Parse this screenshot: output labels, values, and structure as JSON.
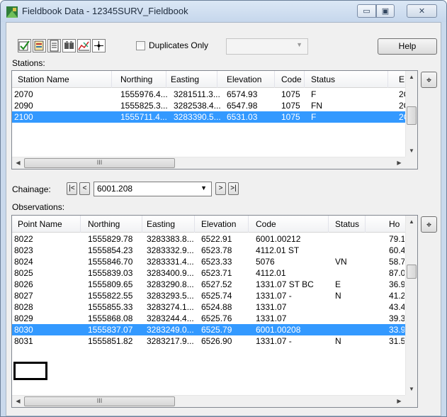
{
  "window": {
    "title": "Fieldbook Data - 12345SURV_Fieldbook",
    "controls": {
      "minimize": "▭",
      "maximize": "▣",
      "close": "✕"
    }
  },
  "toolbar": {
    "icons": [
      "fieldbook-edit-icon",
      "import-icon",
      "report-icon",
      "find-icon",
      "chart-icon",
      "locate-icon"
    ],
    "duplicates_only_label": "Duplicates Only",
    "duplicates_only_checked": false,
    "filter_value": "",
    "help_label": "Help"
  },
  "stations": {
    "label": "Stations:",
    "columns": [
      "Station Name",
      "Northing",
      "Easting",
      "Elevation",
      "Code",
      "Status",
      "E"
    ],
    "rows": [
      [
        "2070",
        "1555976.4...",
        "3281511.3...",
        "6574.93",
        "1075",
        "F",
        "2C"
      ],
      [
        "2090",
        "1555825.3...",
        "3282538.4...",
        "6547.98",
        "1075",
        "FN",
        "2C"
      ],
      [
        "2100",
        "1555711.4...",
        "3283390.5...",
        "6531.03",
        "1075",
        "F",
        "2C"
      ]
    ],
    "selected_row": 2,
    "locate_button": "⌖",
    "hscroll_grip": "III"
  },
  "chainage": {
    "label": "Chainage:",
    "first": "|<",
    "prev": "<",
    "value": "6001.208",
    "next": ">",
    "last": ">|"
  },
  "observations": {
    "label": "Observations:",
    "columns": [
      "Point Name",
      "Northing",
      "Easting",
      "Elevation",
      "Code",
      "Status",
      "Ho"
    ],
    "rows": [
      [
        "8022",
        "1555829.78",
        "3283383.8...",
        "6522.91",
        "6001.00212",
        "",
        "79.1"
      ],
      [
        "8023",
        "1555854.23",
        "3283332.9...",
        "6523.78",
        "4112.01 ST",
        "",
        "60.4"
      ],
      [
        "8024",
        "1555846.70",
        "3283331.4...",
        "6523.33",
        "5076",
        "VN",
        "58.7"
      ],
      [
        "8025",
        "1555839.03",
        "3283400.9...",
        "6523.71",
        "4112.01",
        "",
        "87.0"
      ],
      [
        "8026",
        "1555809.65",
        "3283290.8...",
        "6527.52",
        "1331.07 ST BC",
        "E",
        "36.9"
      ],
      [
        "8027",
        "1555822.55",
        "3283293.5...",
        "6525.74",
        "1331.07 -",
        "N",
        "41.2"
      ],
      [
        "8028",
        "1555855.33",
        "3283274.1...",
        "6524.88",
        "1331.07",
        "",
        "43.4"
      ],
      [
        "8029",
        "1555868.08",
        "3283244.4...",
        "6525.76",
        "1331.07",
        "",
        "39.3"
      ],
      [
        "8030",
        "1555837.07",
        "3283249.0...",
        "6525.79",
        "6001.00208",
        "",
        "33.9"
      ],
      [
        "8031",
        "1555851.82",
        "3283217.9...",
        "6526.90",
        "1331.07 -",
        "N",
        "31.5"
      ]
    ],
    "selected_row": 8,
    "locate_button": "⌖",
    "hscroll_grip": "III"
  },
  "colors": {
    "selection": "#3399ff",
    "frame": "#c9d9ec"
  }
}
